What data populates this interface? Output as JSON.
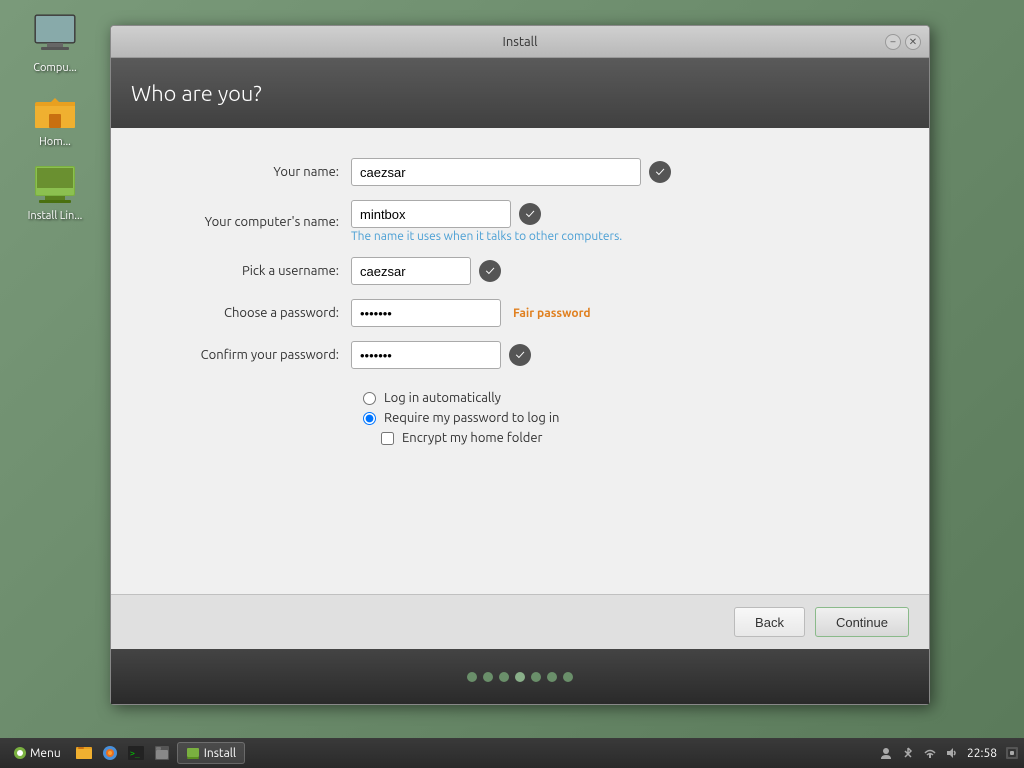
{
  "desktop": {
    "icons": [
      {
        "id": "computer",
        "label": "Compu...",
        "type": "computer"
      },
      {
        "id": "home",
        "label": "Hom...",
        "type": "home"
      },
      {
        "id": "install",
        "label": "Install Lin...",
        "type": "install"
      }
    ]
  },
  "taskbar": {
    "menu_label": "Menu",
    "app_label": "Install",
    "time": "22:58",
    "icons": [
      "file-manager",
      "firefox",
      "terminal",
      "files"
    ]
  },
  "dialog": {
    "title": "Install",
    "heading": "Who are you?",
    "close_label": "✕",
    "minimize_label": "–",
    "form": {
      "your_name_label": "Your name:",
      "your_name_value": "caezsar",
      "computer_name_label": "Your computer's name:",
      "computer_name_value": "mintbox",
      "computer_name_hint": "The name it uses when it talks to other computers.",
      "username_label": "Pick a username:",
      "username_value": "caezsar",
      "password_label": "Choose a password:",
      "password_value": "●●●●●●●",
      "password_strength": "Fair password",
      "confirm_label": "Confirm your password:",
      "confirm_value": "●●●●●●●",
      "option_auto_login": "Log in automatically",
      "option_require_password": "Require my password to log in",
      "option_encrypt": "Encrypt my home folder"
    },
    "buttons": {
      "back": "Back",
      "continue": "Continue"
    },
    "progress_dots": 7,
    "active_dot": 4
  }
}
